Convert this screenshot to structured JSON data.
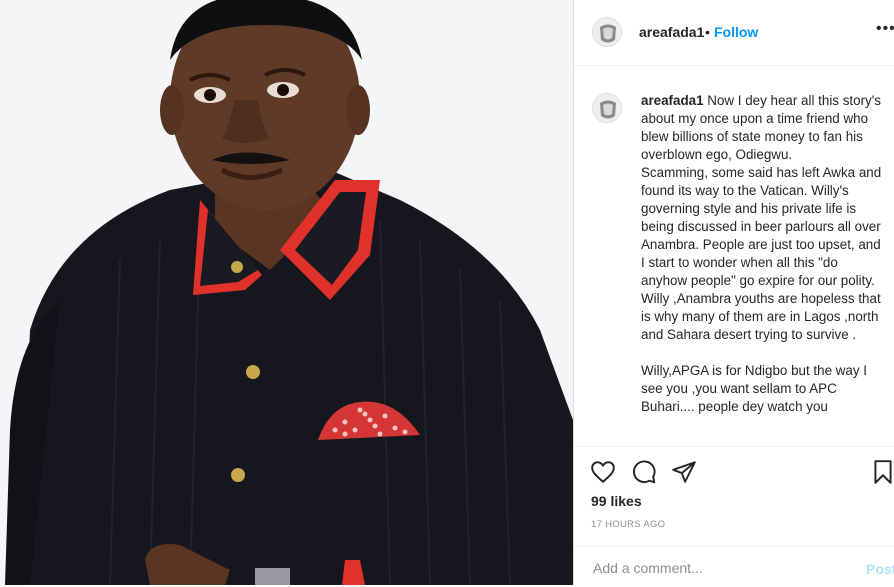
{
  "post": {
    "username": "areafada1",
    "dot": "•",
    "follow_label": "Follow",
    "more_label": "•••",
    "caption_username": "areafada1",
    "caption_text": " Now I dey hear all this story's about my once upon a time friend who blew billions of state money to fan his overblown ego, Odiegwu.\nScamming, some said has left Awka and found its way to the Vatican. Willy's governing style and his private life is being discussed in beer parlours all over Anambra. People are just too upset, and I start to wonder when all this \"do anyhow people\" go expire for our polity. Willy ,Anambra youths are hopeless that is why many of them are in Lagos ,north and Sahara desert trying to survive .\n\nWilly,APGA is for Ndigbo but the way I see you ,you want sellam to APC Buhari.... people dey watch you",
    "likes": "99 likes",
    "time": "17 HOURS AGO",
    "comment_placeholder": "Add a comment...",
    "post_label": "Post"
  },
  "icons": {
    "like": "heart-icon",
    "comment": "comment-icon",
    "share": "paper-plane-icon",
    "save": "bookmark-icon"
  },
  "colors": {
    "follow": "#0095f6",
    "post_disabled": "#b2dffc",
    "text": "#262626",
    "muted": "#8e8e8e"
  }
}
